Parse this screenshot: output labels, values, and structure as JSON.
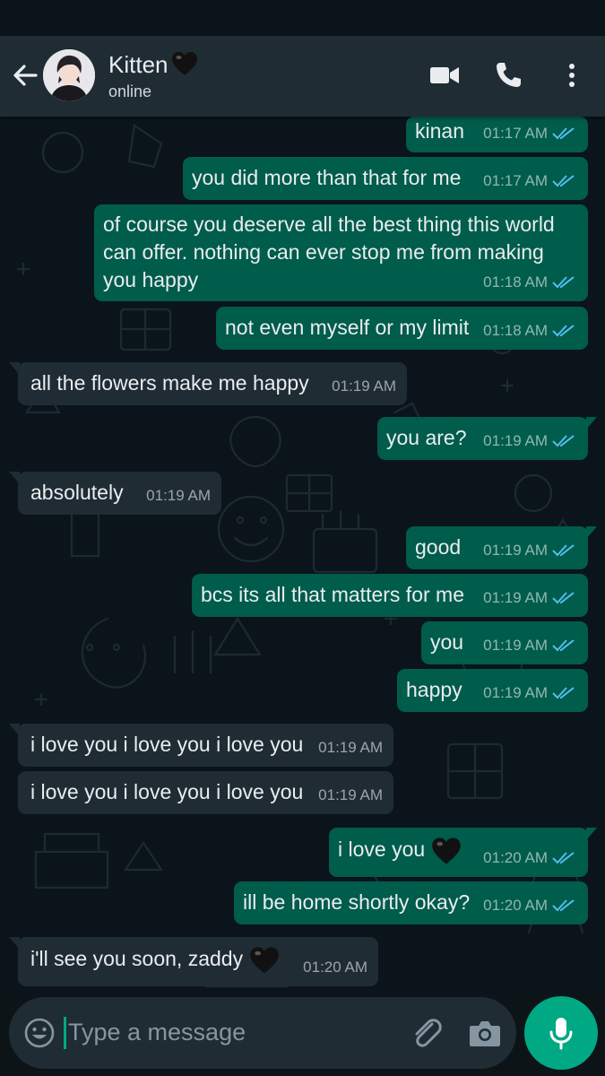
{
  "header": {
    "contact_name": "Kitten",
    "contact_status": "online",
    "icons": [
      "back-arrow-icon",
      "video-call-icon",
      "voice-call-icon",
      "more-menu-icon"
    ]
  },
  "messages": [
    {
      "id": 1,
      "direction": "out",
      "text": "kinan",
      "time": "01:17 AM",
      "status": "read"
    },
    {
      "id": 2,
      "direction": "out",
      "text": "you did more than that for me",
      "time": "01:17 AM",
      "status": "read"
    },
    {
      "id": 3,
      "direction": "out",
      "text": "of course you deserve all the best thing this world can offer. nothing can ever stop me from making you happy",
      "time": "01:18 AM",
      "status": "read"
    },
    {
      "id": 4,
      "direction": "out",
      "text": "not even myself or my limit",
      "time": "01:18 AM",
      "status": "read"
    },
    {
      "id": 5,
      "direction": "in",
      "text": "all the flowers make me happy",
      "time": "01:19 AM"
    },
    {
      "id": 6,
      "direction": "out",
      "text": "you are?",
      "time": "01:19 AM",
      "status": "read"
    },
    {
      "id": 7,
      "direction": "in",
      "text": "absolutely",
      "time": "01:19 AM"
    },
    {
      "id": 8,
      "direction": "out",
      "text": "good",
      "time": "01:19 AM",
      "status": "read"
    },
    {
      "id": 9,
      "direction": "out",
      "text": "bcs its all that matters for me",
      "time": "01:19 AM",
      "status": "read"
    },
    {
      "id": 10,
      "direction": "out",
      "text": "you",
      "time": "01:19 AM",
      "status": "read"
    },
    {
      "id": 11,
      "direction": "out",
      "text": "happy",
      "time": "01:19 AM",
      "status": "read"
    },
    {
      "id": 12,
      "direction": "in",
      "text": "i love you i love you i love you",
      "time": "01:19 AM"
    },
    {
      "id": 13,
      "direction": "in",
      "text": "i love you i love you i love you",
      "time": "01:19 AM"
    },
    {
      "id": 14,
      "direction": "out",
      "text": "i love you",
      "time": "01:20 AM",
      "status": "read",
      "emoji": "black-heart"
    },
    {
      "id": 15,
      "direction": "out",
      "text": "ill be home shortly okay?",
      "time": "01:20 AM",
      "status": "read"
    },
    {
      "id": 16,
      "direction": "in",
      "text": "i'll see you soon, zaddy",
      "time": "01:20 AM",
      "emoji": "black-heart"
    }
  ],
  "message_lines": {
    "m3_line1": "of course you deserve all the best thing this world",
    "m3_line2": "can offer. nothing can ever stop me from making",
    "m3_line3": "you happy"
  },
  "composer": {
    "placeholder": "Type a message",
    "icons": [
      "emoji-icon",
      "attach-icon",
      "camera-icon",
      "mic-icon"
    ]
  },
  "colors": {
    "chat_background": "#0b141a",
    "header_background": "#1f2c34",
    "outgoing_bubble": "#005c4b",
    "incoming_bubble": "#1f2c34",
    "read_tick": "#53bdeb",
    "accent": "#00a884"
  }
}
